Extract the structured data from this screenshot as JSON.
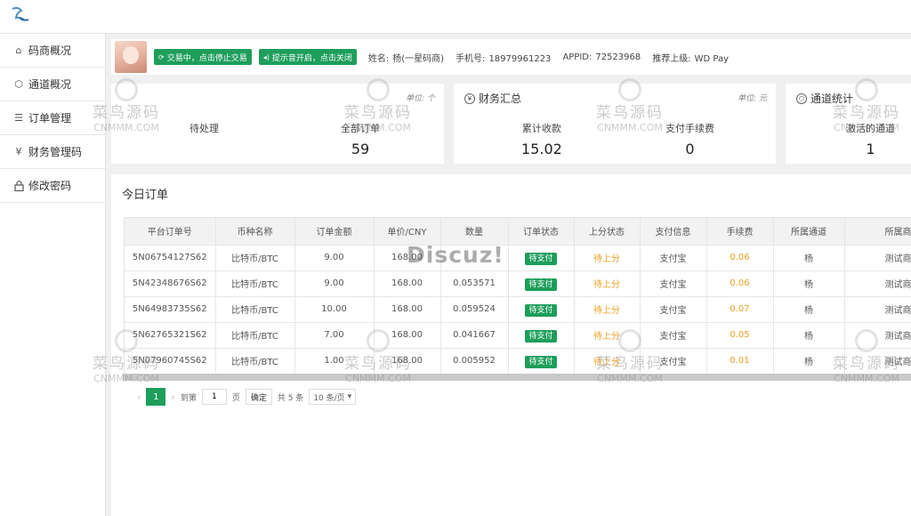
{
  "sidebar": {
    "items": [
      {
        "icon": "home-icon",
        "glyph": "⌂",
        "label": "码商概况"
      },
      {
        "icon": "cube-icon",
        "glyph": "⬡",
        "label": "通道概况"
      },
      {
        "icon": "list-icon",
        "glyph": "☰",
        "label": "订单管理"
      },
      {
        "icon": "money-icon",
        "glyph": "¥",
        "label": "财务管理码"
      },
      {
        "icon": "lock-icon",
        "glyph": "🔒",
        "label": "修改密码"
      }
    ]
  },
  "userbar": {
    "trade_button": "交易中，点击停止交易",
    "sound_button": "提示音开启，点击关闭",
    "name_label": "姓名:",
    "name_value": "杨(一星码商)",
    "phone_label": "手机号:",
    "phone_value": "18979961223",
    "appid_label": "APPID:",
    "appid_value": "72523968",
    "referrer_label": "推荐上级:",
    "referrer_value": "WD Pay"
  },
  "cards": {
    "orders_card": {
      "unit": "单位: 个",
      "stats": [
        {
          "label": "待处理",
          "value": ""
        },
        {
          "label": "全部订单",
          "value": "59"
        }
      ]
    },
    "finance_card": {
      "title": "财务汇总",
      "unit": "单位: 元",
      "stats": [
        {
          "label": "累计收款",
          "value": "15.02"
        },
        {
          "label": "支付手续费",
          "value": "0"
        }
      ]
    },
    "channel_card": {
      "title": "通道统计",
      "stats": [
        {
          "label": "激活的通道",
          "value": "1"
        }
      ]
    }
  },
  "orders": {
    "title": "今日订单",
    "columns": [
      "平台订单号",
      "币种名称",
      "订单金额",
      "单价/CNY",
      "数量",
      "订单状态",
      "上分状态",
      "支付信息",
      "手续费",
      "所属通道",
      "所属商户"
    ],
    "rows": [
      [
        "5N06754127S62",
        "比特币/BTC",
        "9.00",
        "168.00",
        "",
        "待支付",
        "待上分",
        "支付宝",
        "0.06",
        "杨",
        "测试商户"
      ],
      [
        "5N42348676S62",
        "比特币/BTC",
        "9.00",
        "168.00",
        "0.053571",
        "待支付",
        "待上分",
        "支付宝",
        "0.06",
        "杨",
        "测试商户"
      ],
      [
        "5N64983735S62",
        "比特币/BTC",
        "10.00",
        "168.00",
        "0.059524",
        "待支付",
        "待上分",
        "支付宝",
        "0.07",
        "杨",
        "测试商户"
      ],
      [
        "5N62765321S62",
        "比特币/BTC",
        "7.00",
        "168.00",
        "0.041667",
        "待支付",
        "待上分",
        "支付宝",
        "0.05",
        "杨",
        "测试商户"
      ],
      [
        "5N07960745S62",
        "比特币/BTC",
        "1.00",
        "168.00",
        "0.005952",
        "待支付",
        "待上分",
        "支付宝",
        "0.01",
        "杨",
        "测试商户"
      ]
    ]
  },
  "pagination": {
    "current_page": "1",
    "goto_label": "到第",
    "page_input": "1",
    "page_unit": "页",
    "confirm_button": "确定",
    "total": "共 5 条",
    "page_size": "10 条/页"
  },
  "watermarks": {
    "brand": "菜鸟源码",
    "domain": "CNMMM.COM",
    "discuz": "Discuz!"
  },
  "colors": {
    "accent_green": "#1e9e5b",
    "pending_orange": "#f0a020"
  }
}
